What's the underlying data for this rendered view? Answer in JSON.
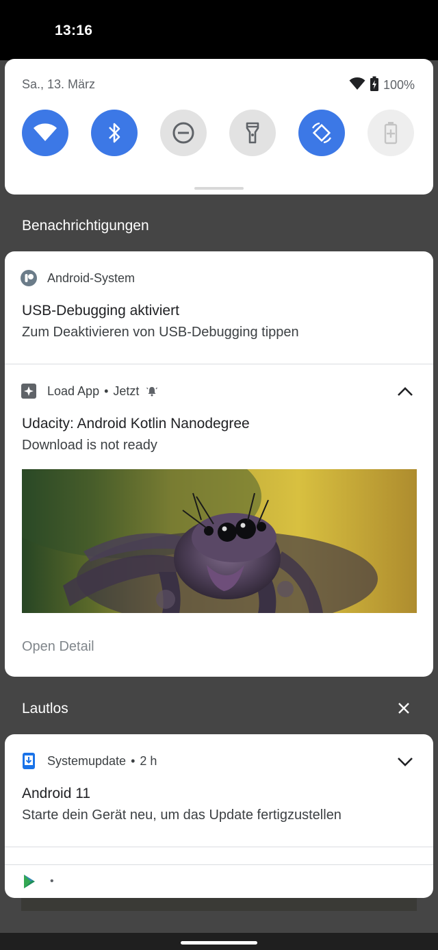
{
  "status_bar": {
    "time": "13:16"
  },
  "quick_settings": {
    "date": "Sa., 13. März",
    "battery": "100%",
    "tiles": [
      {
        "name": "wifi",
        "state": "on"
      },
      {
        "name": "bluetooth",
        "state": "on"
      },
      {
        "name": "do-not-disturb",
        "state": "off"
      },
      {
        "name": "flashlight",
        "state": "off"
      },
      {
        "name": "auto-rotate",
        "state": "on"
      },
      {
        "name": "battery-saver",
        "state": "disabled"
      }
    ]
  },
  "notifications_header": "Benachrichtigungen",
  "usb_notification": {
    "app": "Android-System",
    "title": "USB-Debugging aktiviert",
    "text": "Zum Deaktivieren von USB-Debugging tippen"
  },
  "load_notification": {
    "app": "Load App",
    "time": "Jetzt",
    "title": "Udacity: Android Kotlin Nanodegree",
    "text": "Download is not ready",
    "action": "Open Detail"
  },
  "silent_header": "Lautlos",
  "update_notification": {
    "app": "Systemupdate",
    "time": "2 h",
    "title": "Android 11",
    "text": "Starte dein Gerät neu, um das Update fertigzustellen"
  },
  "colors": {
    "accent": "#3c78e6",
    "shade_background": "#454545",
    "card_background": "#ffffff"
  }
}
